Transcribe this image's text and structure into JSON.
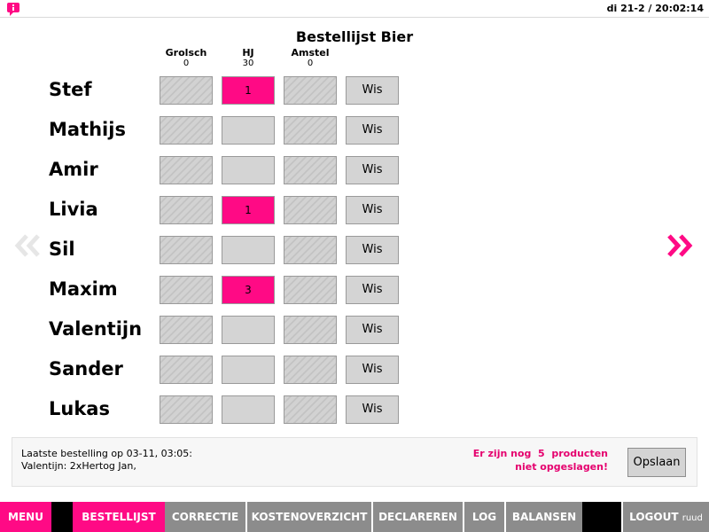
{
  "header": {
    "datetime": "di 21-2 / 20:02:14"
  },
  "title": "Bestellijst Bier",
  "columns": [
    {
      "name": "Grolsch",
      "count": "0"
    },
    {
      "name": "HJ",
      "count": "30"
    },
    {
      "name": "Amstel",
      "count": "0"
    }
  ],
  "clear_label": "Wis",
  "rows": [
    {
      "name": "Stef",
      "cells": [
        "",
        "1",
        ""
      ],
      "states": [
        "locked",
        "filled",
        "locked"
      ]
    },
    {
      "name": "Mathijs",
      "cells": [
        "",
        "",
        ""
      ],
      "states": [
        "locked",
        "open",
        "locked"
      ]
    },
    {
      "name": "Amir",
      "cells": [
        "",
        "",
        ""
      ],
      "states": [
        "locked",
        "open",
        "locked"
      ]
    },
    {
      "name": "Livia",
      "cells": [
        "",
        "1",
        ""
      ],
      "states": [
        "locked",
        "filled",
        "locked"
      ]
    },
    {
      "name": "Sil",
      "cells": [
        "",
        "",
        ""
      ],
      "states": [
        "locked",
        "open",
        "locked"
      ]
    },
    {
      "name": "Maxim",
      "cells": [
        "",
        "3",
        ""
      ],
      "states": [
        "locked",
        "filled",
        "locked"
      ]
    },
    {
      "name": "Valentijn",
      "cells": [
        "",
        "",
        ""
      ],
      "states": [
        "locked",
        "open",
        "locked"
      ]
    },
    {
      "name": "Sander",
      "cells": [
        "",
        "",
        ""
      ],
      "states": [
        "locked",
        "open",
        "locked"
      ]
    },
    {
      "name": "Lukas",
      "cells": [
        "",
        "",
        ""
      ],
      "states": [
        "locked",
        "open",
        "locked"
      ]
    }
  ],
  "footer_panel": {
    "last_order_line1": "Laatste bestelling op 03-11, 03:05:",
    "last_order_line2": "Valentijn: 2xHertog Jan,",
    "unsaved_line1": "Er zijn nog  5  producten",
    "unsaved_line2": "niet opgeslagen!",
    "save_label": "Opslaan"
  },
  "nav": {
    "menu": "MENU",
    "bestellijst": "BESTELLIJST",
    "correctie": "CORRECTIE",
    "kostenoverzicht": "KOSTENOVERZICHT",
    "declareren": "DECLAREREN",
    "log": "LOG",
    "balansen": "BALANSEN",
    "logout": "LOGOUT",
    "user": "ruud"
  },
  "icons": {
    "info": "info-bubble-icon",
    "prev": "double-chevron-left-icon",
    "next": "double-chevron-right-icon"
  },
  "colors": {
    "accent": "#ff0a85",
    "accent_text": "#e5006e",
    "nav_gray": "#8c8c8c",
    "nav_black": "#000000",
    "cell_gray": "#d4d4d4",
    "arrow_inactive": "#e6e6e6"
  }
}
